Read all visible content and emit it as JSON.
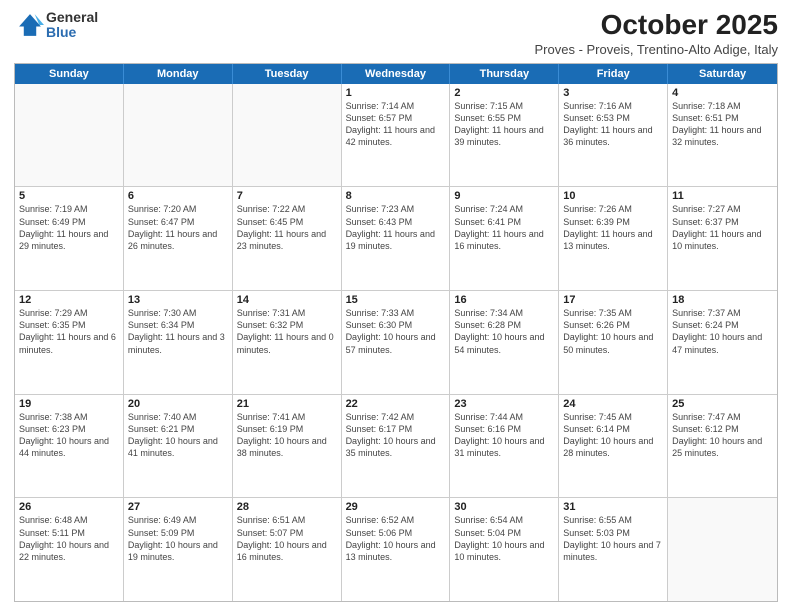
{
  "logo": {
    "general": "General",
    "blue": "Blue"
  },
  "title": "October 2025",
  "subtitle": "Proves - Proveis, Trentino-Alto Adige, Italy",
  "days_of_week": [
    "Sunday",
    "Monday",
    "Tuesday",
    "Wednesday",
    "Thursday",
    "Friday",
    "Saturday"
  ],
  "weeks": [
    [
      {
        "day": "",
        "info": ""
      },
      {
        "day": "",
        "info": ""
      },
      {
        "day": "",
        "info": ""
      },
      {
        "day": "1",
        "info": "Sunrise: 7:14 AM\nSunset: 6:57 PM\nDaylight: 11 hours and 42 minutes."
      },
      {
        "day": "2",
        "info": "Sunrise: 7:15 AM\nSunset: 6:55 PM\nDaylight: 11 hours and 39 minutes."
      },
      {
        "day": "3",
        "info": "Sunrise: 7:16 AM\nSunset: 6:53 PM\nDaylight: 11 hours and 36 minutes."
      },
      {
        "day": "4",
        "info": "Sunrise: 7:18 AM\nSunset: 6:51 PM\nDaylight: 11 hours and 32 minutes."
      }
    ],
    [
      {
        "day": "5",
        "info": "Sunrise: 7:19 AM\nSunset: 6:49 PM\nDaylight: 11 hours and 29 minutes."
      },
      {
        "day": "6",
        "info": "Sunrise: 7:20 AM\nSunset: 6:47 PM\nDaylight: 11 hours and 26 minutes."
      },
      {
        "day": "7",
        "info": "Sunrise: 7:22 AM\nSunset: 6:45 PM\nDaylight: 11 hours and 23 minutes."
      },
      {
        "day": "8",
        "info": "Sunrise: 7:23 AM\nSunset: 6:43 PM\nDaylight: 11 hours and 19 minutes."
      },
      {
        "day": "9",
        "info": "Sunrise: 7:24 AM\nSunset: 6:41 PM\nDaylight: 11 hours and 16 minutes."
      },
      {
        "day": "10",
        "info": "Sunrise: 7:26 AM\nSunset: 6:39 PM\nDaylight: 11 hours and 13 minutes."
      },
      {
        "day": "11",
        "info": "Sunrise: 7:27 AM\nSunset: 6:37 PM\nDaylight: 11 hours and 10 minutes."
      }
    ],
    [
      {
        "day": "12",
        "info": "Sunrise: 7:29 AM\nSunset: 6:35 PM\nDaylight: 11 hours and 6 minutes."
      },
      {
        "day": "13",
        "info": "Sunrise: 7:30 AM\nSunset: 6:34 PM\nDaylight: 11 hours and 3 minutes."
      },
      {
        "day": "14",
        "info": "Sunrise: 7:31 AM\nSunset: 6:32 PM\nDaylight: 11 hours and 0 minutes."
      },
      {
        "day": "15",
        "info": "Sunrise: 7:33 AM\nSunset: 6:30 PM\nDaylight: 10 hours and 57 minutes."
      },
      {
        "day": "16",
        "info": "Sunrise: 7:34 AM\nSunset: 6:28 PM\nDaylight: 10 hours and 54 minutes."
      },
      {
        "day": "17",
        "info": "Sunrise: 7:35 AM\nSunset: 6:26 PM\nDaylight: 10 hours and 50 minutes."
      },
      {
        "day": "18",
        "info": "Sunrise: 7:37 AM\nSunset: 6:24 PM\nDaylight: 10 hours and 47 minutes."
      }
    ],
    [
      {
        "day": "19",
        "info": "Sunrise: 7:38 AM\nSunset: 6:23 PM\nDaylight: 10 hours and 44 minutes."
      },
      {
        "day": "20",
        "info": "Sunrise: 7:40 AM\nSunset: 6:21 PM\nDaylight: 10 hours and 41 minutes."
      },
      {
        "day": "21",
        "info": "Sunrise: 7:41 AM\nSunset: 6:19 PM\nDaylight: 10 hours and 38 minutes."
      },
      {
        "day": "22",
        "info": "Sunrise: 7:42 AM\nSunset: 6:17 PM\nDaylight: 10 hours and 35 minutes."
      },
      {
        "day": "23",
        "info": "Sunrise: 7:44 AM\nSunset: 6:16 PM\nDaylight: 10 hours and 31 minutes."
      },
      {
        "day": "24",
        "info": "Sunrise: 7:45 AM\nSunset: 6:14 PM\nDaylight: 10 hours and 28 minutes."
      },
      {
        "day": "25",
        "info": "Sunrise: 7:47 AM\nSunset: 6:12 PM\nDaylight: 10 hours and 25 minutes."
      }
    ],
    [
      {
        "day": "26",
        "info": "Sunrise: 6:48 AM\nSunset: 5:11 PM\nDaylight: 10 hours and 22 minutes."
      },
      {
        "day": "27",
        "info": "Sunrise: 6:49 AM\nSunset: 5:09 PM\nDaylight: 10 hours and 19 minutes."
      },
      {
        "day": "28",
        "info": "Sunrise: 6:51 AM\nSunset: 5:07 PM\nDaylight: 10 hours and 16 minutes."
      },
      {
        "day": "29",
        "info": "Sunrise: 6:52 AM\nSunset: 5:06 PM\nDaylight: 10 hours and 13 minutes."
      },
      {
        "day": "30",
        "info": "Sunrise: 6:54 AM\nSunset: 5:04 PM\nDaylight: 10 hours and 10 minutes."
      },
      {
        "day": "31",
        "info": "Sunrise: 6:55 AM\nSunset: 5:03 PM\nDaylight: 10 hours and 7 minutes."
      },
      {
        "day": "",
        "info": ""
      }
    ]
  ]
}
